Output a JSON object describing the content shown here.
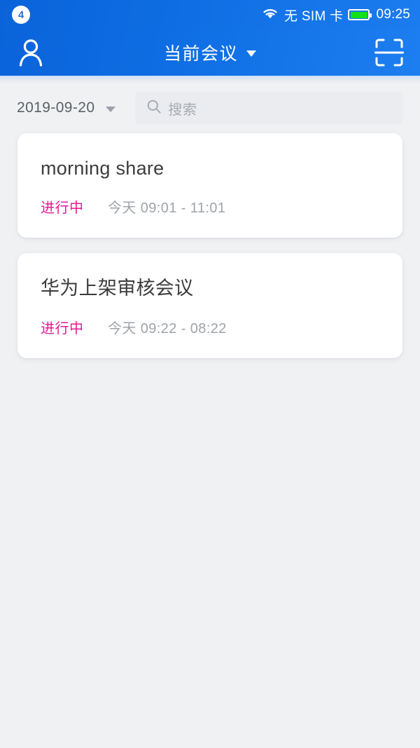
{
  "status_bar": {
    "notification_count": "4",
    "wifi_icon": "wifi-icon",
    "sim_status": "无 SIM 卡",
    "battery_icon": "battery-full-icon",
    "time": "09:25"
  },
  "nav_bar": {
    "profile_icon": "user-profile-icon",
    "title": "当前会议",
    "dropdown_icon": "chevron-down-icon",
    "scan_icon": "qr-scan-icon"
  },
  "filter": {
    "date": "2019-09-20",
    "date_dropdown_icon": "chevron-down-icon",
    "search_icon": "search-icon",
    "search_placeholder": "搜索",
    "search_value": ""
  },
  "meetings": [
    {
      "title": "morning share",
      "status": "进行中",
      "time": "今天 09:01 - 11:01"
    },
    {
      "title": "华为上架审核会议",
      "status": "进行中",
      "time": "今天 09:22 - 08:22"
    }
  ],
  "colors": {
    "header_blue": "#1070e5",
    "status_pink": "#e61a93",
    "page_background": "#f0f1f3",
    "card_white": "#ffffff",
    "battery_green": "#12e112"
  }
}
